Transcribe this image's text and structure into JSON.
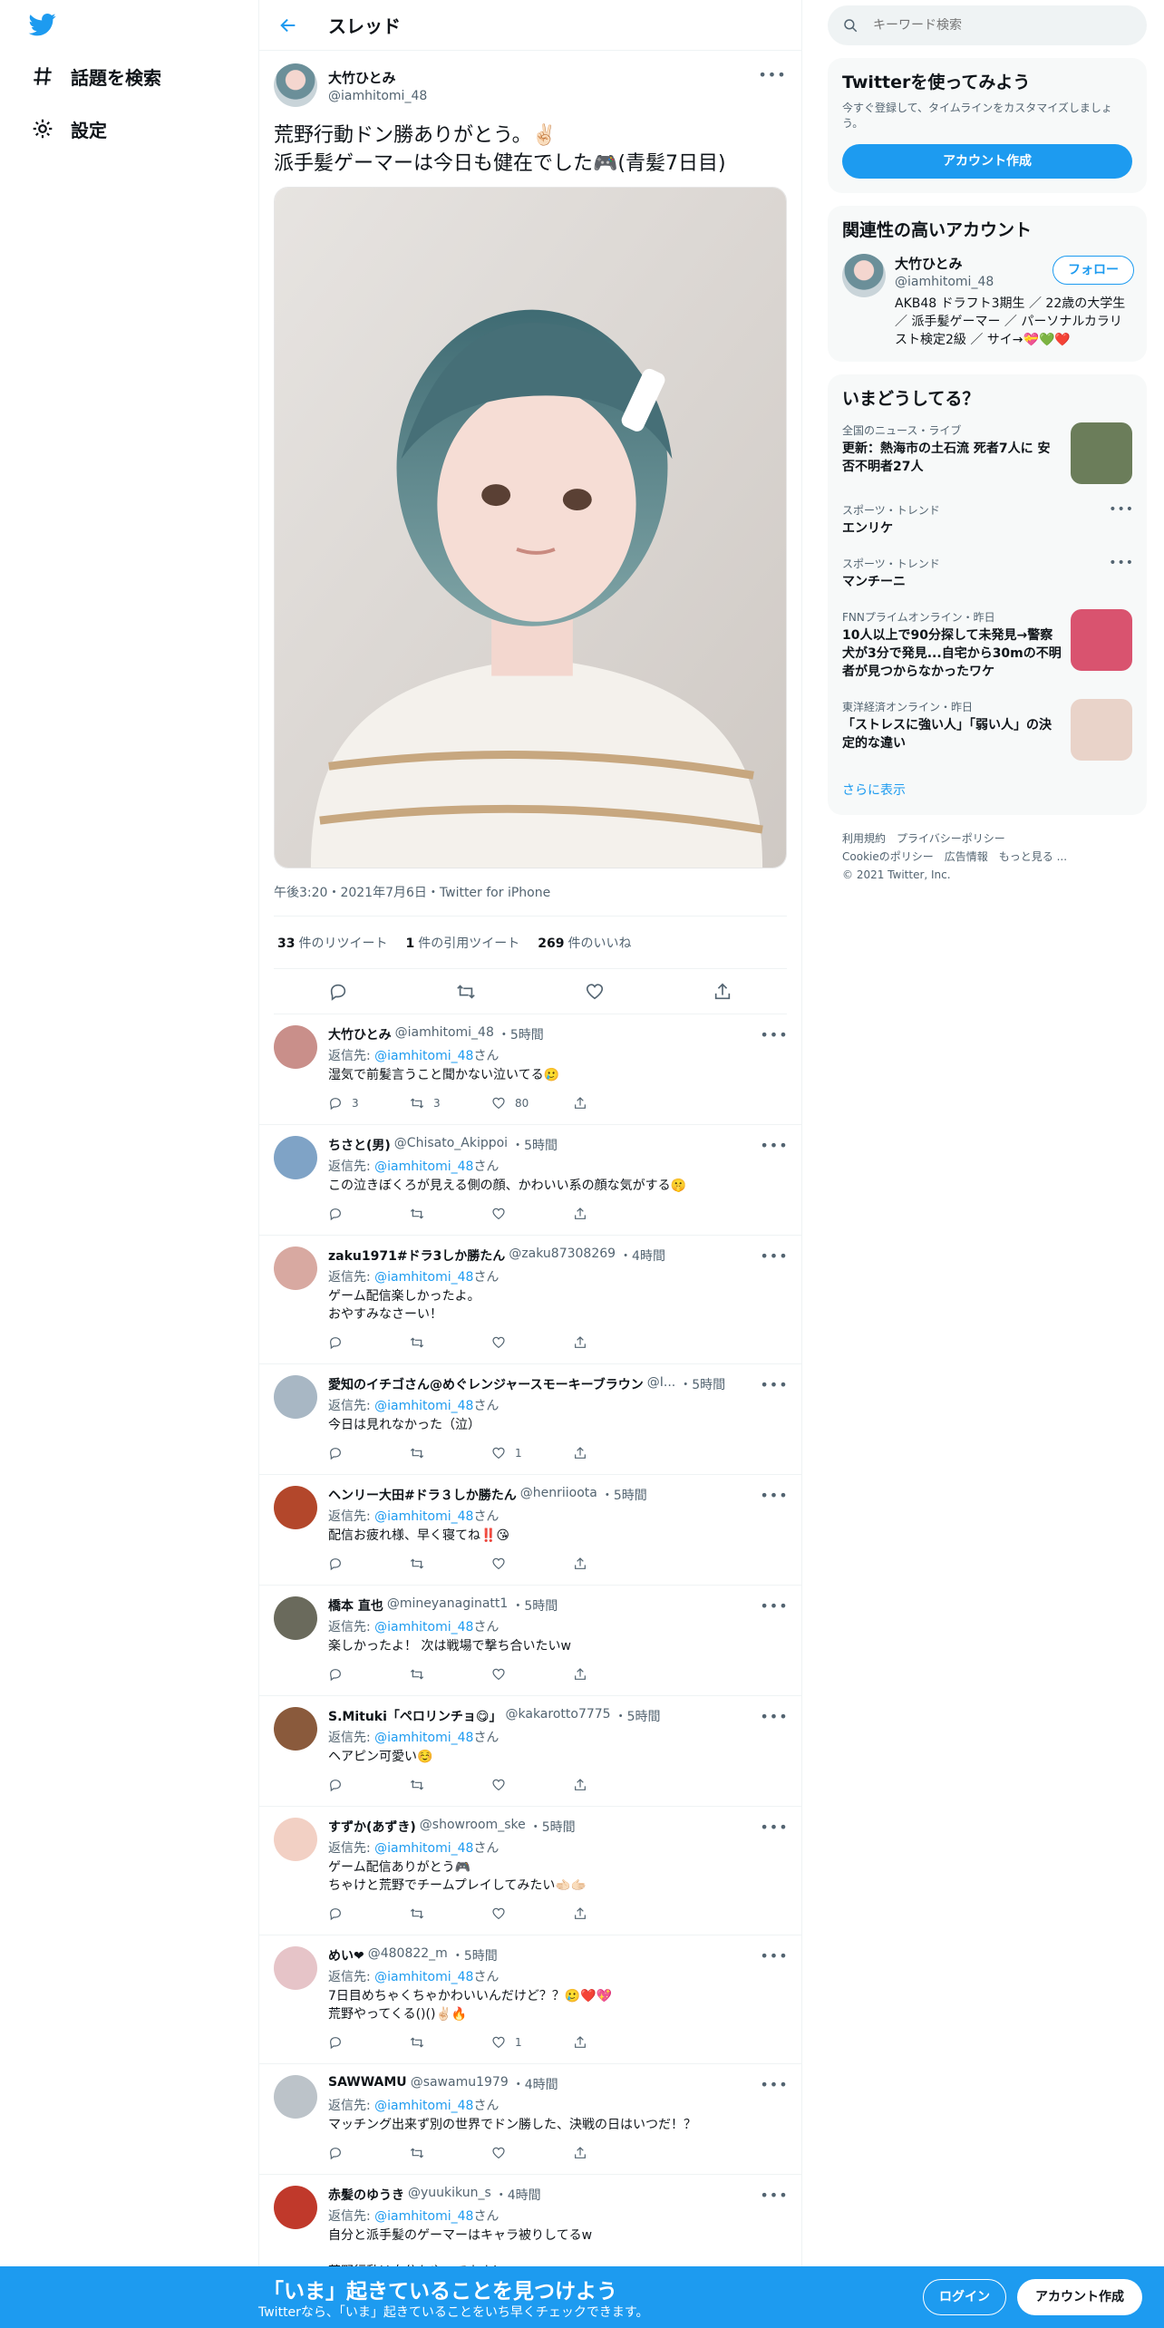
{
  "nav": {
    "explore_label": "話題を検索",
    "settings_label": "設定"
  },
  "header": {
    "title": "スレッド"
  },
  "main_tweet": {
    "name": "大竹ひとみ",
    "handle": "@iamhitomi_48",
    "text": "荒野行動ドン勝ありがとう。✌🏻\n派手髪ゲーマーは今日も健在でした🎮(青髪7日目)",
    "meta": "午後3:20・2021年7月6日・Twitter for iPhone",
    "retweets_count": "33",
    "retweets_label": "件のリツイート",
    "quotes_count": "1",
    "quotes_label": "件の引用ツイート",
    "likes_count": "269",
    "likes_label": "件のいいね"
  },
  "reply_to_label": "返信先: ",
  "reply_to_handle": "@iamhitomi_48",
  "reply_to_suffix": "さん",
  "replies": [
    {
      "name": "大竹ひとみ",
      "handle": "@iamhitomi_48",
      "time": "・5時間",
      "text": "湿気で前髪言うこと聞かない泣いてる🥲",
      "replies": "3",
      "retweets": "3",
      "likes": "80",
      "avatar_color": "#c98f8a"
    },
    {
      "name": "ちさと(男)",
      "handle": "@Chisato_Akippoi",
      "time": "・5時間",
      "text": "この泣きぼくろが見える側の顔、かわいい系の顔な気がする🤫",
      "replies": "",
      "retweets": "",
      "likes": "",
      "avatar_color": "#7fa3c6"
    },
    {
      "name": "zaku1971#ドラ3しか勝たん",
      "handle": "@zaku87308269",
      "time": "・4時間",
      "text": "ゲーム配信楽しかったよ。\nおやすみなさーい！",
      "replies": "",
      "retweets": "",
      "likes": "",
      "avatar_color": "#d8a9a1"
    },
    {
      "name": "愛知のイチゴさん@めぐレンジャースモーキーブラウン",
      "handle": "@I...",
      "time": "・5時間",
      "text": "今日は見れなかった（泣）",
      "replies": "",
      "retweets": "",
      "likes": "1",
      "avatar_color": "#a8b7c4"
    },
    {
      "name": "ヘンリー大田#ドラ３しか勝たん",
      "handle": "@henriioota",
      "time": "・5時間",
      "text": "配信お疲れ様、早く寝てね‼️😘",
      "replies": "",
      "retweets": "",
      "likes": "",
      "avatar_color": "#b3472b"
    },
    {
      "name": "橋本 直也",
      "handle": "@mineyanaginatt1",
      "time": "・5時間",
      "text": "楽しかったよ！ 次は戦場で撃ち合いたいw",
      "replies": "",
      "retweets": "",
      "likes": "",
      "avatar_color": "#6a6a5c"
    },
    {
      "name": "S.Mituki「ペロリンチョ😋」",
      "handle": "@kakarotto7775",
      "time": "・5時間",
      "text": "ヘアピン可愛い☺️",
      "replies": "",
      "retweets": "",
      "likes": "",
      "avatar_color": "#8a5a3c"
    },
    {
      "name": "すずか(あずき)",
      "handle": "@showroom_ske",
      "time": "・5時間",
      "text": "ゲーム配信ありがとう🎮\nちゃけと荒野でチームプレイしてみたい🫲🏻🫱🏻",
      "replies": "",
      "retweets": "",
      "likes": "",
      "avatar_color": "#f2d0c4"
    },
    {
      "name": "めい❤",
      "handle": "@480822_m",
      "time": "・5時間",
      "text": "7日目めちゃくちゃかわいいんだけど？？🥲❤️💖\n荒野やってくる()()✌🏻🔥",
      "replies": "",
      "retweets": "",
      "likes": "1",
      "avatar_color": "#e6c4c8"
    },
    {
      "name": "SAWWAMU",
      "handle": "@sawamu1979",
      "time": "・4時間",
      "text": "マッチング出来ず別の世界でドン勝した、決戦の日はいつだ！？",
      "replies": "",
      "retweets": "",
      "likes": "",
      "avatar_color": "#bcc3c9"
    },
    {
      "name": "赤髪のゆうき",
      "handle": "@yuukikun_s",
      "time": "・4時間",
      "text": "自分と派手髪のゲーマーはキャラ被りしてるw\n\n荒野行動は自分もやってます！",
      "replies": "",
      "retweets": "",
      "likes": "",
      "avatar_color": "#c0392b"
    }
  ],
  "search": {
    "placeholder": "キーワード検索"
  },
  "signup_card": {
    "title": "Twitterを使ってみよう",
    "subtitle": "今すぐ登録して、タイムラインをカスタマイズしましょう。",
    "button": "アカウント作成"
  },
  "relevant": {
    "title": "関連性の高いアカウント",
    "name": "大竹ひとみ",
    "handle": "@iamhitomi_48",
    "bio": "AKB48 ドラフト3期生 ／ 22歳の大学生 ／ 派手髪ゲーマー ／ パーソナルカラリスト検定2級 ／ サイ→💝💚❤️",
    "follow": "フォロー"
  },
  "trends": {
    "title": "いまどうしてる？",
    "items": [
      {
        "category": "全国のニュース・ライブ",
        "text": "更新：熱海市の土石流 死者7人に 安否不明者27人",
        "thumb": "#6b7d5a"
      },
      {
        "category": "スポーツ・トレンド",
        "text": "エンリケ",
        "thumb": ""
      },
      {
        "category": "スポーツ・トレンド",
        "text": "マンチーニ",
        "thumb": ""
      },
      {
        "category": "FNNプライムオンライン・昨日",
        "text": "10人以上で90分探して未発見→警察犬が3分で発見...自宅から30mの不明者が見つからなかったワケ",
        "thumb": "#d9536f"
      },
      {
        "category": "東洋経済オンライン・昨日",
        "text": "「ストレスに強い人」「弱い人」の決定的な違い",
        "thumb": "#e9d3c9"
      }
    ],
    "show_more": "さらに表示"
  },
  "footer": {
    "terms": "利用規約",
    "privacy": "プライバシーポリシー",
    "cookie": "Cookieのポリシー",
    "ads": "広告情報",
    "more": "もっと見る ...",
    "copyright": "© 2021 Twitter, Inc."
  },
  "bottom_bar": {
    "title": "「いま」起きていることを見つけよう",
    "subtitle": "Twitterなら、「いま」起きていることをいち早くチェックできます。",
    "login": "ログイン",
    "signup": "アカウント作成"
  }
}
